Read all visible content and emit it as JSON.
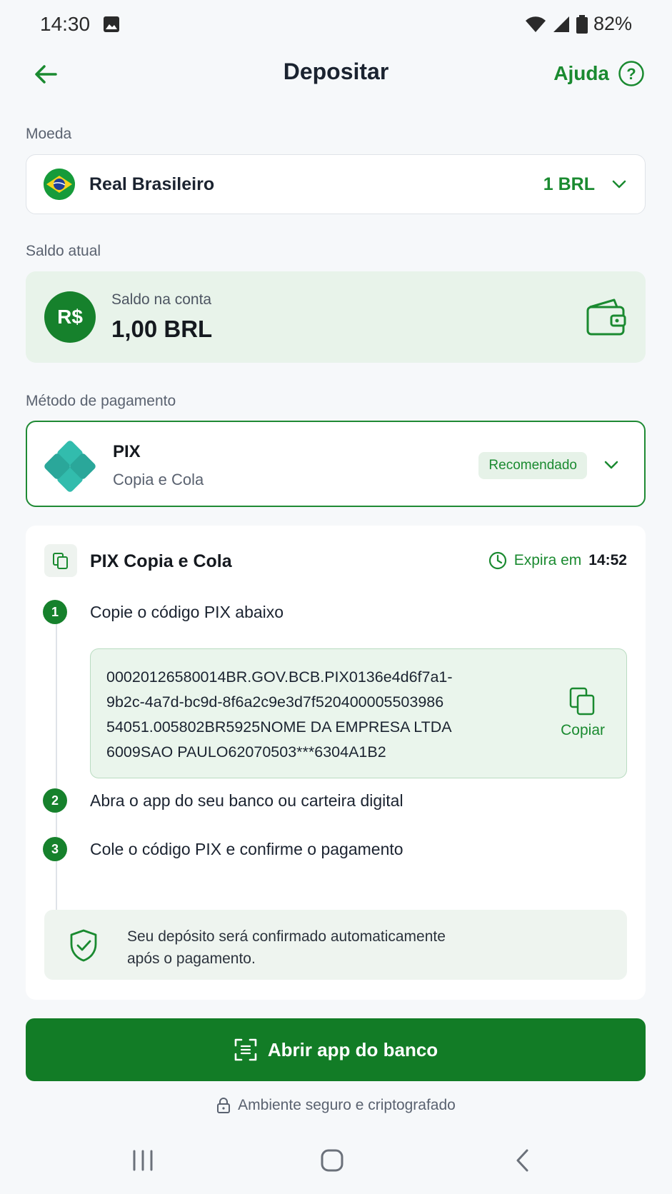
{
  "status_bar": {
    "time": "14:30",
    "battery": "82%"
  },
  "header": {
    "title": "Depositar",
    "help_label": "Ajuda"
  },
  "currency": {
    "section_label": "Moeda",
    "name": "Real Brasileiro",
    "amount": "1 BRL"
  },
  "balance": {
    "section_label": "Saldo atual",
    "symbol": "R$",
    "label": "Saldo na conta",
    "value": "1,00 BRL"
  },
  "payment": {
    "section_label": "Método de pagamento",
    "name": "PIX",
    "subtitle": "Copia e Cola",
    "badge": "Recomendado"
  },
  "instructions": {
    "title": "PIX Copia e Cola",
    "expire_prefix": "Expira em",
    "expire_time": "14:52",
    "steps": [
      {
        "num": "1",
        "text": "Copie o código PIX abaixo"
      },
      {
        "num": "2",
        "text": "Abra o app do seu banco ou carteira digital"
      },
      {
        "num": "3",
        "text": "Cole o código PIX e confirme o pagamento"
      }
    ],
    "pix_code": "00020126580014BR.GOV.BCB.PIX0136e4d6f7a1-\n9b2c-4a7d-bc9d-8f6a2c9e3d7f520400005503986\n54051.005802BR5925NOME DA EMPRESA LTDA\n6009SAO PAULO62070503***6304A1B2",
    "copy_label": "Copiar",
    "secure_note": "Seu depósito será confirmado automaticamente\napós o pagamento."
  },
  "cta": {
    "label": "Abrir app do banco"
  },
  "footer": {
    "security_text": "Ambiente seguro e criptografado"
  },
  "colors": {
    "primary": "#127c26",
    "accent_text": "#1a8a30",
    "soft_green": "#e8f3ea",
    "pix_teal": "#32bcad"
  }
}
